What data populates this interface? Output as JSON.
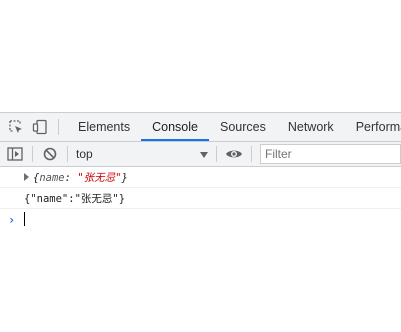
{
  "tabs": [
    {
      "label": "Elements",
      "active": false
    },
    {
      "label": "Console",
      "active": true
    },
    {
      "label": "Sources",
      "active": false
    },
    {
      "label": "Network",
      "active": false
    },
    {
      "label": "Performance",
      "active": false
    }
  ],
  "toolbar": {
    "context": "top",
    "filter_placeholder": "Filter"
  },
  "console": {
    "messages": [
      {
        "type": "object",
        "open": "{",
        "key": "name",
        "colon": ": ",
        "value": "\"张无忌\"",
        "close": "}"
      },
      {
        "type": "text",
        "text": "{\"name\":\"张无忌\"}"
      }
    ],
    "prompt": "›"
  },
  "icons": {
    "inspect": "inspect-element-icon",
    "device": "device-toolbar-icon",
    "sidebar": "show-sidebar-icon",
    "clear": "clear-console-icon",
    "dropdown": "dropdown-arrow-icon",
    "eye": "live-expression-icon",
    "expander": "expand-triangle-icon"
  },
  "colors": {
    "accent": "#1a73e8",
    "string": "#c80000",
    "toolbar_bg": "#f1f3f4",
    "border": "#cbcdd1"
  }
}
